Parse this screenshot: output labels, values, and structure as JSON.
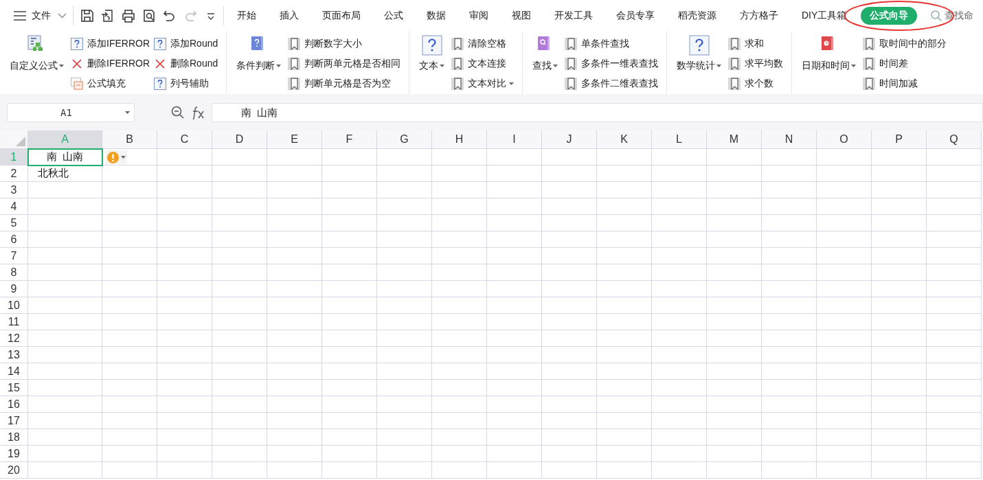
{
  "menu": {
    "file_label": "文件",
    "tabs": [
      {
        "label": "开始",
        "selected": false
      },
      {
        "label": "插入",
        "selected": false
      },
      {
        "label": "页面布局",
        "selected": false
      },
      {
        "label": "公式",
        "selected": false
      },
      {
        "label": "数据",
        "selected": false
      },
      {
        "label": "审阅",
        "selected": false
      },
      {
        "label": "视图",
        "selected": false
      },
      {
        "label": "开发工具",
        "selected": false
      },
      {
        "label": "会员专享",
        "selected": false
      },
      {
        "label": "稻壳资源",
        "selected": false
      },
      {
        "label": "方方格子",
        "selected": false
      },
      {
        "label": "DIY工具箱",
        "selected": false
      },
      {
        "label": "公式向导",
        "selected": true
      }
    ],
    "search": {
      "placeholder": "查找命"
    }
  },
  "ribbon": {
    "groups": [
      {
        "big": {
          "label": "自定义公式",
          "kind": "tree",
          "dropdown": true
        },
        "columns": [
          [
            {
              "label": "添加IFERROR",
              "kind": "help"
            },
            {
              "label": "删除IFERROR",
              "kind": "delete"
            },
            {
              "label": "公式填充",
              "kind": "fill"
            }
          ],
          [
            {
              "label": "添加Round",
              "kind": "help"
            },
            {
              "label": "删除Round",
              "kind": "delete"
            },
            {
              "label": "列号辅助",
              "kind": "help"
            }
          ]
        ]
      },
      {
        "big": {
          "label": "条件判断",
          "kind": "book-blue",
          "dropdown": true
        },
        "columns": [
          [
            {
              "label": "判断数字大小",
              "kind": "bookmark"
            },
            {
              "label": "判断两单元格是否相同",
              "kind": "bookmark"
            },
            {
              "label": "判断单元格是否为空",
              "kind": "bookmark"
            }
          ]
        ]
      },
      {
        "big": {
          "label": "文本",
          "kind": "help-big",
          "dropdown": true
        },
        "columns": [
          [
            {
              "label": "清除空格",
              "kind": "bookmark"
            },
            {
              "label": "文本连接",
              "kind": "bookmark"
            },
            {
              "label": "文本对比",
              "kind": "bookmark",
              "dropdown": true
            }
          ]
        ]
      },
      {
        "big": {
          "label": "查找",
          "kind": "book-purple",
          "dropdown": true
        },
        "columns": [
          [
            {
              "label": "单条件查找",
              "kind": "bookmark"
            },
            {
              "label": "多条件一维表查找",
              "kind": "bookmark"
            },
            {
              "label": "多条件二维表查找",
              "kind": "bookmark"
            }
          ]
        ]
      },
      {
        "big": {
          "label": "数学统计",
          "kind": "help-big",
          "dropdown": true
        },
        "columns": [
          [
            {
              "label": "求和",
              "kind": "bookmark"
            },
            {
              "label": "求平均数",
              "kind": "bookmark"
            },
            {
              "label": "求个数",
              "kind": "bookmark"
            }
          ]
        ]
      },
      {
        "big": {
          "label": "日期和时间",
          "kind": "book-red",
          "dropdown": true
        },
        "columns": [
          [
            {
              "label": "取时间中的部分",
              "kind": "bookmark"
            },
            {
              "label": "时间差",
              "kind": "bookmark"
            },
            {
              "label": "时间加减",
              "kind": "bookmark"
            }
          ]
        ]
      }
    ]
  },
  "formula_bar": {
    "name_box": "A1",
    "formula": "南  山南"
  },
  "sheet": {
    "columns": [
      {
        "label": "A",
        "selected": true
      },
      {
        "label": "B",
        "selected": false
      },
      {
        "label": "C",
        "selected": false
      },
      {
        "label": "D",
        "selected": false
      },
      {
        "label": "E",
        "selected": false
      },
      {
        "label": "F",
        "selected": false
      },
      {
        "label": "G",
        "selected": false
      },
      {
        "label": "H",
        "selected": false
      },
      {
        "label": "I",
        "selected": false
      },
      {
        "label": "J",
        "selected": false
      },
      {
        "label": "K",
        "selected": false
      },
      {
        "label": "L",
        "selected": false
      },
      {
        "label": "M",
        "selected": false
      },
      {
        "label": "N",
        "selected": false
      },
      {
        "label": "O",
        "selected": false
      },
      {
        "label": "P",
        "selected": false
      },
      {
        "label": "Q",
        "selected": false
      }
    ],
    "rows": [
      {
        "label": "1",
        "selected": true,
        "cells": [
          {
            "text": "南  山南",
            "kind": "centered",
            "selected": true,
            "warning": true
          }
        ]
      },
      {
        "label": "2",
        "selected": false,
        "cells": [
          {
            "text": "北秋北",
            "kind": "plain",
            "selected": false,
            "warning": false
          }
        ]
      },
      {
        "label": "3",
        "selected": false
      },
      {
        "label": "4",
        "selected": false
      },
      {
        "label": "5",
        "selected": false
      },
      {
        "label": "6",
        "selected": false
      },
      {
        "label": "7",
        "selected": false
      },
      {
        "label": "8",
        "selected": false
      },
      {
        "label": "9",
        "selected": false
      },
      {
        "label": "10",
        "selected": false
      },
      {
        "label": "11",
        "selected": false
      },
      {
        "label": "12",
        "selected": false
      },
      {
        "label": "13",
        "selected": false
      },
      {
        "label": "14",
        "selected": false
      },
      {
        "label": "15",
        "selected": false
      },
      {
        "label": "16",
        "selected": false
      },
      {
        "label": "17",
        "selected": false
      },
      {
        "label": "18",
        "selected": false
      },
      {
        "label": "19",
        "selected": false
      },
      {
        "label": "20",
        "selected": false
      }
    ]
  }
}
